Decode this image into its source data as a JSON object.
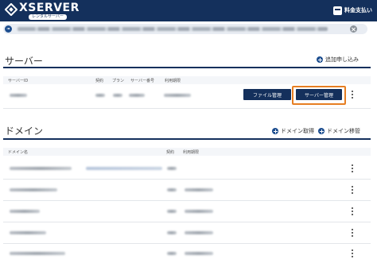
{
  "header": {
    "logo_text": "XSERVER",
    "logo_sub": "レンタルサーバー",
    "pay_label": "料金支払い",
    "bg_color": "#14305c"
  },
  "notice": {
    "icon": "megaphone-icon",
    "close_icon": "close-icon"
  },
  "server_section": {
    "title": "サーバー",
    "add_label": "追加申し込み",
    "columns": [
      "サーバーID",
      "契約",
      "プラン",
      "サーバー番号",
      "利用期限"
    ],
    "file_manager_label": "ファイル管理",
    "server_manager_label": "サーバー管理"
  },
  "domain_section": {
    "title": "ドメイン",
    "acquire_label": "ドメイン取得",
    "transfer_label": "ドメイン移管",
    "columns": [
      "ドメイン名",
      "契約",
      "利用期限"
    ],
    "row_count": 5
  },
  "colors": {
    "primary": "#14305c",
    "highlight": "#e67e22",
    "accent": "#1d4e8f"
  }
}
